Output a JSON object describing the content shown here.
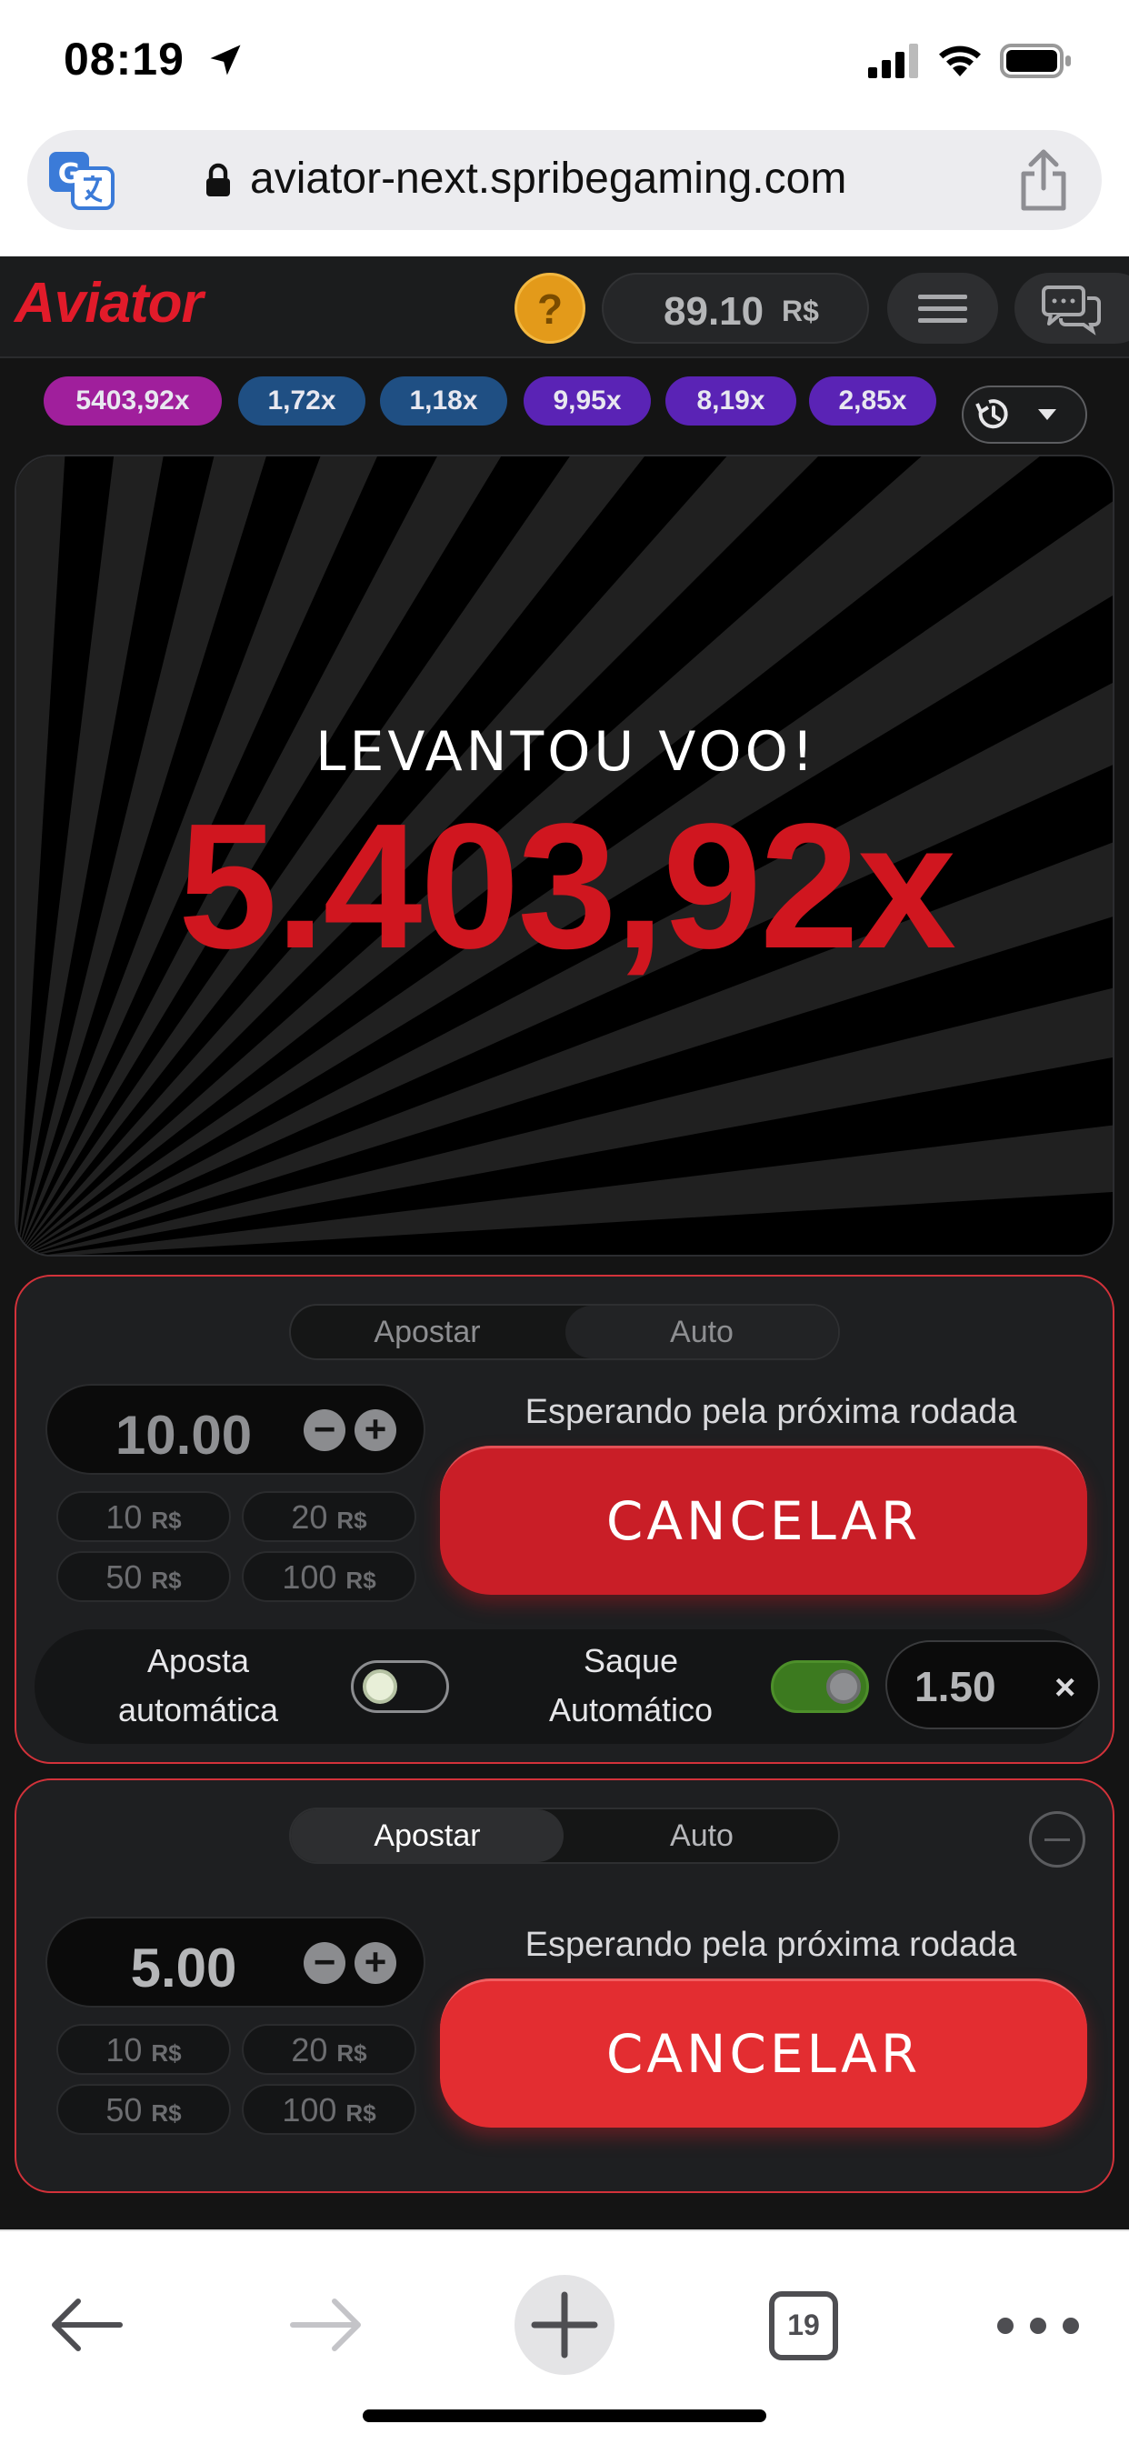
{
  "status_bar": {
    "time": "08:19"
  },
  "browser": {
    "url": "aviator-next.spribegaming.com",
    "tab_count": "19"
  },
  "header": {
    "logo": "Aviator",
    "help_symbol": "?",
    "balance_amount": "89.10",
    "balance_currency": "R$"
  },
  "history": [
    {
      "label": "5403,92x",
      "color": "#a01f9c"
    },
    {
      "label": "1,72x",
      "color": "#1f4f83"
    },
    {
      "label": "1,18x",
      "color": "#1f4f83"
    },
    {
      "label": "9,95x",
      "color": "#5a23b5"
    },
    {
      "label": "8,19x",
      "color": "#5a23b5"
    },
    {
      "label": "2,85x",
      "color": "#5a23b5"
    }
  ],
  "game": {
    "status": "LEVANTOU VOO!",
    "multiplier": "5.403,92x",
    "multiplier_color": "#d0161f"
  },
  "bet1": {
    "tabs": [
      "Apostar",
      "Auto"
    ],
    "stake": "10.00",
    "minus": "−",
    "plus": "+",
    "quick": [
      {
        "amount": "10",
        "currency": "R$"
      },
      {
        "amount": "20",
        "currency": "R$"
      },
      {
        "amount": "50",
        "currency": "R$"
      },
      {
        "amount": "100",
        "currency": "R$"
      }
    ],
    "waiting": "Esperando pela próxima rodada",
    "cancel": "CANCELAR",
    "auto_bet_label": "Aposta automática",
    "auto_cashout_label": "Saque Automático",
    "auto_bet_on": false,
    "auto_cashout_on": true,
    "cashout_value": "1.50",
    "cashout_clear": "×"
  },
  "bet2": {
    "tabs": [
      "Apostar",
      "Auto"
    ],
    "stake": "5.00",
    "minus": "−",
    "plus": "+",
    "quick": [
      {
        "amount": "10",
        "currency": "R$"
      },
      {
        "amount": "20",
        "currency": "R$"
      },
      {
        "amount": "50",
        "currency": "R$"
      },
      {
        "amount": "100",
        "currency": "R$"
      }
    ],
    "waiting": "Esperando pela próxima rodada",
    "cancel": "CANCELAR"
  },
  "colors": {
    "accent_red": "#e21b2a",
    "panel_border": "#d3323a",
    "toggle_on": "#3c7a1f"
  }
}
